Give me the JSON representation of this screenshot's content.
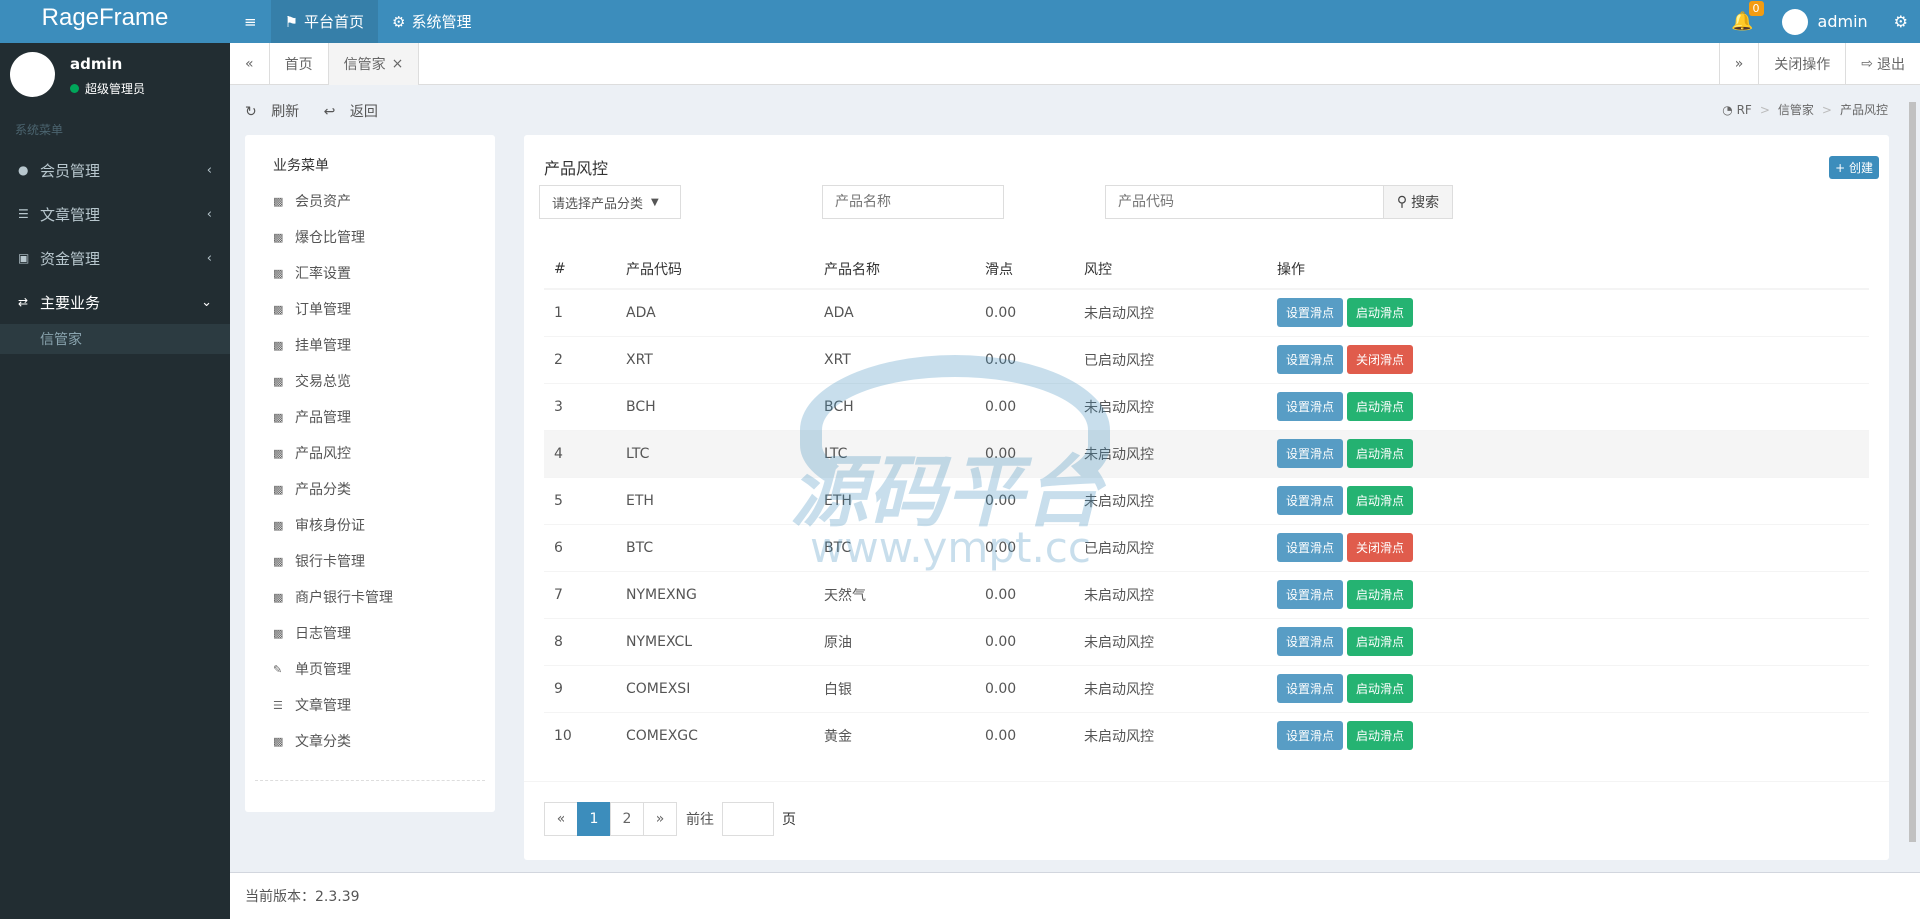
{
  "app": {
    "title": "RageFrame"
  },
  "topnav": {
    "menu_icon": "≡",
    "items": [
      {
        "label": "平台首页"
      },
      {
        "label": "系统管理"
      }
    ],
    "notification_count": "0",
    "username": "admin"
  },
  "sidebar": {
    "user": {
      "name": "admin",
      "role": "超级管理员"
    },
    "section": "系统菜单",
    "items": [
      {
        "label": "会员管理"
      },
      {
        "label": "文章管理"
      },
      {
        "label": "资金管理"
      },
      {
        "label": "主要业务"
      }
    ],
    "subitems": [
      {
        "label": "信管家"
      }
    ]
  },
  "tabs": {
    "home": "首页",
    "current": "信管家",
    "close_ops": "关闭操作",
    "logout": "退出"
  },
  "toolbar": {
    "refresh": "刷新",
    "back": "返回"
  },
  "breadcrumb": {
    "root": "RF",
    "parent": "信管家",
    "current": "产品风控"
  },
  "business_menu": {
    "title": "业务菜单",
    "items": [
      {
        "label": "会员资产"
      },
      {
        "label": "爆仓比管理"
      },
      {
        "label": "汇率设置"
      },
      {
        "label": "订单管理"
      },
      {
        "label": "挂单管理"
      },
      {
        "label": "交易总览"
      },
      {
        "label": "产品管理"
      },
      {
        "label": "产品风控"
      },
      {
        "label": "产品分类"
      },
      {
        "label": "审核身份证"
      },
      {
        "label": "银行卡管理"
      },
      {
        "label": "商户银行卡管理"
      },
      {
        "label": "日志管理"
      },
      {
        "label": "单页管理"
      },
      {
        "label": "文章管理"
      },
      {
        "label": "文章分类"
      }
    ]
  },
  "main": {
    "title": "产品风控",
    "create_label": "创建",
    "filter": {
      "category_placeholder": "请选择产品分类",
      "name_placeholder": "产品名称",
      "code_placeholder": "产品代码",
      "search_label": "搜索"
    },
    "columns": [
      "#",
      "产品代码",
      "产品名称",
      "滑点",
      "风控",
      "操作"
    ],
    "rows": [
      {
        "id": "1",
        "code": "ADA",
        "name": "ADA",
        "slip": "0.00",
        "risk": "未启动风控",
        "toggle": "启动滑点",
        "toggle_kind": "on"
      },
      {
        "id": "2",
        "code": "XRT",
        "name": "XRT",
        "slip": "0.00",
        "risk": "已启动风控",
        "toggle": "关闭滑点",
        "toggle_kind": "off"
      },
      {
        "id": "3",
        "code": "BCH",
        "name": "BCH",
        "slip": "0.00",
        "risk": "未启动风控",
        "toggle": "启动滑点",
        "toggle_kind": "on"
      },
      {
        "id": "4",
        "code": "LTC",
        "name": "LTC",
        "slip": "0.00",
        "risk": "未启动风控",
        "toggle": "启动滑点",
        "toggle_kind": "on"
      },
      {
        "id": "5",
        "code": "ETH",
        "name": "ETH",
        "slip": "0.00",
        "risk": "未启动风控",
        "toggle": "启动滑点",
        "toggle_kind": "on"
      },
      {
        "id": "6",
        "code": "BTC",
        "name": "BTC",
        "slip": "0.00",
        "risk": "已启动风控",
        "toggle": "关闭滑点",
        "toggle_kind": "off"
      },
      {
        "id": "7",
        "code": "NYMEXNG",
        "name": "天然气",
        "slip": "0.00",
        "risk": "未启动风控",
        "toggle": "启动滑点",
        "toggle_kind": "on"
      },
      {
        "id": "8",
        "code": "NYMEXCL",
        "name": "原油",
        "slip": "0.00",
        "risk": "未启动风控",
        "toggle": "启动滑点",
        "toggle_kind": "on"
      },
      {
        "id": "9",
        "code": "COMEXSI",
        "name": "白银",
        "slip": "0.00",
        "risk": "未启动风控",
        "toggle": "启动滑点",
        "toggle_kind": "on"
      },
      {
        "id": "10",
        "code": "COMEXGC",
        "name": "黄金",
        "slip": "0.00",
        "risk": "未启动风控",
        "toggle": "启动滑点",
        "toggle_kind": "on"
      }
    ],
    "set_label": "设置滑点"
  },
  "pagination": {
    "prev": "«",
    "pages": [
      "1",
      "2"
    ],
    "next": "»",
    "goto_label": "前往",
    "page_suffix": "页"
  },
  "footer": {
    "version": "当前版本：2.3.39"
  },
  "watermark": {
    "line1": "源码平台",
    "line2": "www.ympt.cc"
  },
  "colors": {
    "primary": "#3c8dbc",
    "success": "#00a65a",
    "danger": "#dd4b39",
    "sidebar": "#222d32"
  }
}
